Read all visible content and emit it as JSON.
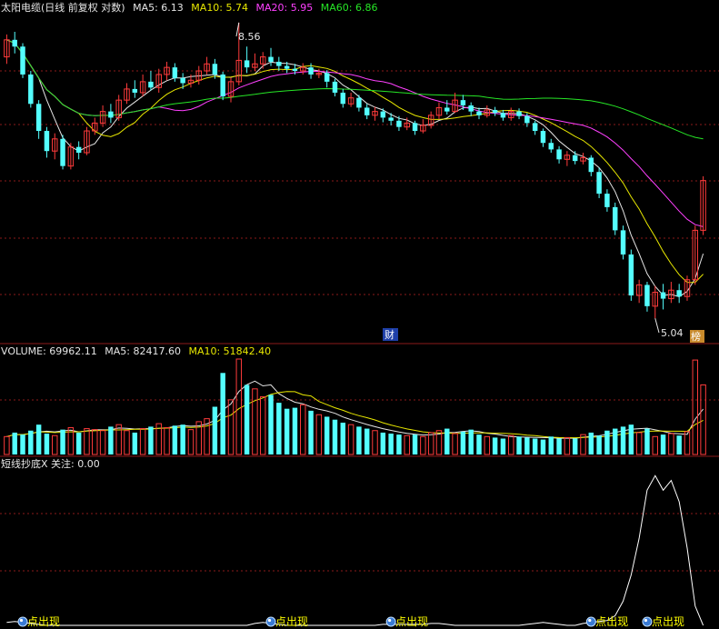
{
  "colors": {
    "background": "#000000",
    "up": "#ff3b3b",
    "down": "#54ffff",
    "ma5": "#e6e6e6",
    "ma10": "#e8e800",
    "ma20": "#ff40ff",
    "ma60": "#26e626",
    "grid": "#8b1a1a",
    "indicator": "#ffffff",
    "label": "#e6e6e6"
  },
  "header": {
    "title": "太阳电缆(日线 前复权 对数)",
    "ma5": "MA5: 6.13",
    "ma10": "MA10: 5.74",
    "ma20": "MA20: 5.95",
    "ma60": "MA60: 6.86"
  },
  "volume_header": {
    "volume": "VOLUME: 69962.11",
    "ma5": "MA5: 82417.60",
    "ma10": "MA10: 51842.40"
  },
  "indicator_header": {
    "title": "短线抄底X 关注: 0.00"
  },
  "annotations": {
    "high_label": "8.56",
    "low_label": "5.04",
    "cai_badge": "财",
    "bang_badge": "榜",
    "signal_label": "点出现"
  },
  "chart_data": {
    "type": "candlestick",
    "title": "太阳电缆(日线 前复权 对数)",
    "price_high": 8.56,
    "price_low": 5.04,
    "ma_latest": {
      "MA5": 6.13,
      "MA10": 5.74,
      "MA20": 5.95,
      "MA60": 6.86
    },
    "volume_latest": {
      "VOLUME": 69962.11,
      "MA5": 82417.6,
      "MA10": 51842.4
    },
    "indicator_latest": {
      "name": "短线抄底X",
      "关注": 0.0
    },
    "candles": [
      [
        8.05,
        8.3,
        8.38,
        7.95
      ],
      [
        8.3,
        8.2,
        8.42,
        8.1
      ],
      [
        8.2,
        7.8,
        8.25,
        7.75
      ],
      [
        7.8,
        7.4,
        7.85,
        7.35
      ],
      [
        7.4,
        7.05,
        7.45,
        6.95
      ],
      [
        7.05,
        6.8,
        7.1,
        6.72
      ],
      [
        6.8,
        6.95,
        7.02,
        6.7
      ],
      [
        6.95,
        6.62,
        7.0,
        6.58
      ],
      [
        6.62,
        6.85,
        6.9,
        6.58
      ],
      [
        6.85,
        6.78,
        6.92,
        6.7
      ],
      [
        6.78,
        7.05,
        7.1,
        6.75
      ],
      [
        7.05,
        7.15,
        7.22,
        7.0
      ],
      [
        7.15,
        7.3,
        7.38,
        7.1
      ],
      [
        7.3,
        7.22,
        7.4,
        7.15
      ],
      [
        7.22,
        7.45,
        7.52,
        7.18
      ],
      [
        7.45,
        7.6,
        7.68,
        7.4
      ],
      [
        7.6,
        7.55,
        7.72,
        7.48
      ],
      [
        7.55,
        7.7,
        7.8,
        7.5
      ],
      [
        7.7,
        7.62,
        7.85,
        7.58
      ],
      [
        7.62,
        7.8,
        7.88,
        7.55
      ],
      [
        7.8,
        7.9,
        7.98,
        7.72
      ],
      [
        7.9,
        7.75,
        7.96,
        7.7
      ],
      [
        7.75,
        7.68,
        7.82,
        7.6
      ],
      [
        7.68,
        7.72,
        7.8,
        7.62
      ],
      [
        7.72,
        7.85,
        7.92,
        7.66
      ],
      [
        7.85,
        7.95,
        8.05,
        7.8
      ],
      [
        7.95,
        7.8,
        8.02,
        7.74
      ],
      [
        7.8,
        7.5,
        7.84,
        7.45
      ],
      [
        7.5,
        7.7,
        7.76,
        7.42
      ],
      [
        7.7,
        8.0,
        8.56,
        7.65
      ],
      [
        8.0,
        7.9,
        8.2,
        7.82
      ],
      [
        7.9,
        7.95,
        8.1,
        7.85
      ],
      [
        7.95,
        8.05,
        8.12,
        7.88
      ],
      [
        8.05,
        7.98,
        8.18,
        7.92
      ],
      [
        7.98,
        7.92,
        8.05,
        7.85
      ],
      [
        7.92,
        7.88,
        7.98,
        7.82
      ],
      [
        7.88,
        7.85,
        7.95,
        7.8
      ],
      [
        7.85,
        7.9,
        7.96,
        7.8
      ],
      [
        7.9,
        7.8,
        7.96,
        7.74
      ],
      [
        7.8,
        7.82,
        7.88,
        7.75
      ],
      [
        7.82,
        7.7,
        7.86,
        7.62
      ],
      [
        7.7,
        7.55,
        7.74,
        7.5
      ],
      [
        7.55,
        7.4,
        7.6,
        7.35
      ],
      [
        7.4,
        7.48,
        7.55,
        7.36
      ],
      [
        7.48,
        7.35,
        7.52,
        7.3
      ],
      [
        7.35,
        7.25,
        7.4,
        7.2
      ],
      [
        7.25,
        7.3,
        7.36,
        7.18
      ],
      [
        7.3,
        7.22,
        7.34,
        7.16
      ],
      [
        7.22,
        7.18,
        7.28,
        7.12
      ],
      [
        7.18,
        7.1,
        7.24,
        7.05
      ],
      [
        7.1,
        7.15,
        7.22,
        7.06
      ],
      [
        7.15,
        7.05,
        7.18,
        7.0
      ],
      [
        7.05,
        7.12,
        7.2,
        7.02
      ],
      [
        7.12,
        7.25,
        7.3,
        7.08
      ],
      [
        7.25,
        7.35,
        7.42,
        7.2
      ],
      [
        7.35,
        7.3,
        7.45,
        7.26
      ],
      [
        7.3,
        7.45,
        7.55,
        7.28
      ],
      [
        7.45,
        7.38,
        7.52,
        7.32
      ],
      [
        7.38,
        7.3,
        7.42,
        7.24
      ],
      [
        7.3,
        7.25,
        7.35,
        7.2
      ],
      [
        7.25,
        7.32,
        7.38,
        7.22
      ],
      [
        7.32,
        7.28,
        7.36,
        7.24
      ],
      [
        7.28,
        7.22,
        7.32,
        7.18
      ],
      [
        7.22,
        7.3,
        7.35,
        7.18
      ],
      [
        7.3,
        7.24,
        7.34,
        7.2
      ],
      [
        7.24,
        7.15,
        7.28,
        7.1
      ],
      [
        7.15,
        7.05,
        7.18,
        7.0
      ],
      [
        7.05,
        6.9,
        7.08,
        6.85
      ],
      [
        6.9,
        6.82,
        6.95,
        6.78
      ],
      [
        6.82,
        6.7,
        6.86,
        6.65
      ],
      [
        6.7,
        6.75,
        6.8,
        6.62
      ],
      [
        6.75,
        6.68,
        6.8,
        6.64
      ],
      [
        6.68,
        6.72,
        6.78,
        6.64
      ],
      [
        6.72,
        6.55,
        6.75,
        6.5
      ],
      [
        6.55,
        6.3,
        6.6,
        6.25
      ],
      [
        6.3,
        6.15,
        6.35,
        6.1
      ],
      [
        6.15,
        5.9,
        6.2,
        5.85
      ],
      [
        5.9,
        5.65,
        5.95,
        5.6
      ],
      [
        5.65,
        5.25,
        5.7,
        5.2
      ],
      [
        5.25,
        5.35,
        5.4,
        5.18
      ],
      [
        5.35,
        5.15,
        5.38,
        5.1
      ],
      [
        5.15,
        5.28,
        5.34,
        5.04
      ],
      [
        5.28,
        5.22,
        5.36,
        5.12
      ],
      [
        5.22,
        5.3,
        5.38,
        5.18
      ],
      [
        5.3,
        5.24,
        5.36,
        5.18
      ],
      [
        5.24,
        5.4,
        5.44,
        5.2
      ],
      [
        5.4,
        5.9,
        5.95,
        5.35
      ],
      [
        5.9,
        6.45,
        6.5,
        5.85
      ]
    ],
    "volume": [
      18,
      22,
      20,
      24,
      30,
      21,
      19,
      25,
      27,
      22,
      26,
      25,
      24,
      28,
      30,
      24,
      22,
      26,
      28,
      31,
      27,
      29,
      30,
      25,
      33,
      36,
      48,
      82,
      55,
      96,
      70,
      66,
      58,
      60,
      52,
      46,
      47,
      50,
      44,
      40,
      38,
      35,
      32,
      30,
      28,
      26,
      24,
      22,
      21,
      20,
      19,
      20,
      18,
      22,
      24,
      26,
      21,
      23,
      25,
      20,
      18,
      17,
      16,
      19,
      18,
      17,
      16,
      15,
      18,
      16,
      17,
      16,
      20,
      22,
      19,
      24,
      26,
      28,
      30,
      22,
      26,
      18,
      20,
      21,
      19,
      23,
      95,
      70
    ],
    "indicator": [
      3,
      4,
      3,
      2,
      1,
      0,
      0,
      0,
      0,
      0,
      0,
      0,
      0,
      0,
      0,
      0,
      0,
      0,
      0,
      0,
      0,
      0,
      0,
      0,
      0,
      0,
      0,
      0,
      0,
      0,
      0,
      2,
      3,
      2,
      1,
      0,
      0,
      0,
      0,
      0,
      0,
      0,
      0,
      0,
      0,
      0,
      0,
      1,
      1,
      1,
      1,
      1,
      1,
      2,
      2,
      1,
      0,
      0,
      0,
      0,
      0,
      0,
      0,
      0,
      0,
      1,
      2,
      3,
      2,
      1,
      0,
      0,
      2,
      3,
      4,
      5,
      10,
      25,
      52,
      90,
      140,
      155,
      140,
      150,
      128,
      80,
      20,
      0
    ],
    "signals": [
      2,
      33,
      48,
      73,
      80
    ]
  }
}
